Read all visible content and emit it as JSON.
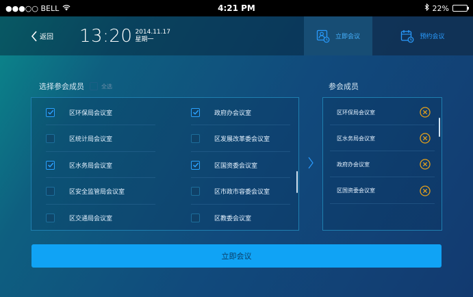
{
  "statusbar": {
    "carrier": "●●●○○ BELL",
    "time": "4:21 PM",
    "battery": "22%",
    "battery_level": 0.22
  },
  "header": {
    "back_label": "返回",
    "clock_time": "13:20",
    "clock_date": "2014.11.17",
    "clock_weekday": "星期一",
    "tabs": [
      {
        "label": "立即会议",
        "icon": "meeting-now-icon",
        "active": true
      },
      {
        "label": "预约会议",
        "icon": "calendar-schedule-icon",
        "active": false
      }
    ]
  },
  "select": {
    "title": "选择参会成员",
    "select_all_label": "全选",
    "rooms": [
      {
        "name": "区环保局会议室",
        "checked": true
      },
      {
        "name": "政府办会议室",
        "checked": true
      },
      {
        "name": "区统计局会议室",
        "checked": false
      },
      {
        "name": "区发展改革委会议室",
        "checked": false
      },
      {
        "name": "区水务局会议室",
        "checked": true
      },
      {
        "name": "区国资委会议室",
        "checked": true
      },
      {
        "name": "区安全监管局会议室",
        "checked": false
      },
      {
        "name": "区市政市容委会议室",
        "checked": false
      },
      {
        "name": "区交通局会议室",
        "checked": false
      },
      {
        "name": "区教委会议室",
        "checked": false
      }
    ]
  },
  "members": {
    "title": "参会成员",
    "items": [
      "区环保局会议室",
      "区水务局会议室",
      "政府办会议室",
      "区国资委会议室"
    ]
  },
  "action": {
    "start_label": "立即会议"
  },
  "colors": {
    "accent": "#10a3f5",
    "remove": "#e6a11a",
    "check": "#2aa3ff"
  }
}
